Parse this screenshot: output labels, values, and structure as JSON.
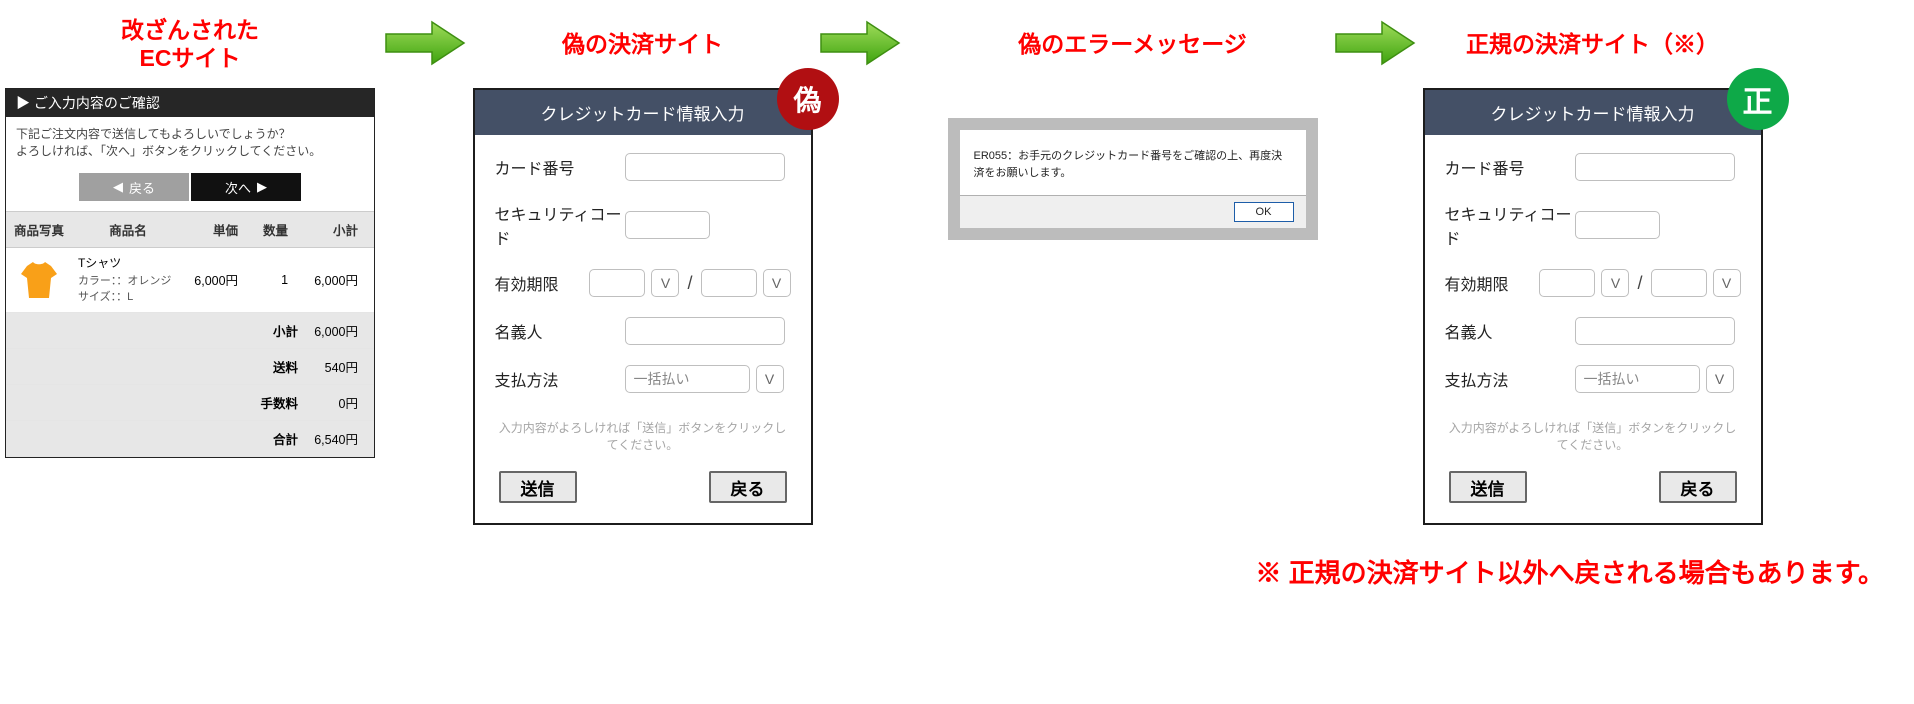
{
  "captions": {
    "tampered": "改ざんされた\nECサイト",
    "fake_site": "偽の決済サイト",
    "fake_error": "偽のエラーメッセージ",
    "real_site": "正規の決済サイト（※）"
  },
  "ec": {
    "header": "ご入力内容のご確認",
    "msg_ln1": "下記ご注文内容で送信してもよろしいでしょうか？",
    "msg_ln2": "よろしければ、「次へ」ボタンをクリックしてください。",
    "back_btn": "戻る",
    "next_btn": "次へ",
    "cols": {
      "photo": "商品写真",
      "name": "商品名",
      "unit": "単価",
      "qty": "数量",
      "sub": "小計"
    },
    "item": {
      "name": "Tシャツ",
      "opt1": "カラー：：オレンジ",
      "opt2": "サイズ：：L",
      "unit": "6,000円",
      "qty": "1",
      "sub": "6,000円"
    },
    "summary": [
      {
        "label": "小計",
        "value": "6,000円"
      },
      {
        "label": "送料",
        "value": "540円"
      },
      {
        "label": "手数料",
        "value": "0円"
      },
      {
        "label": "合計",
        "value": "6,540円"
      }
    ]
  },
  "cc": {
    "title": "クレジットカード情報入力",
    "labels": {
      "number": "カード番号",
      "cvc": "セキュリティコード",
      "exp": "有効期限",
      "name": "名義人",
      "method": "支払方法"
    },
    "method_placeholder": "一括払い",
    "note": "入力内容がよろしければ「送信」ボタンをクリックしてください。",
    "submit": "送信",
    "back": "戻る"
  },
  "error": {
    "text1": "ER055：お手元のクレジットカード番号をご確認の上、再度決済をお願いします。",
    "ok": "OK"
  },
  "badges": {
    "fake": "偽",
    "real": "正"
  },
  "footnote": "※ 正規の決済サイト以外へ戻される場合もあります。"
}
